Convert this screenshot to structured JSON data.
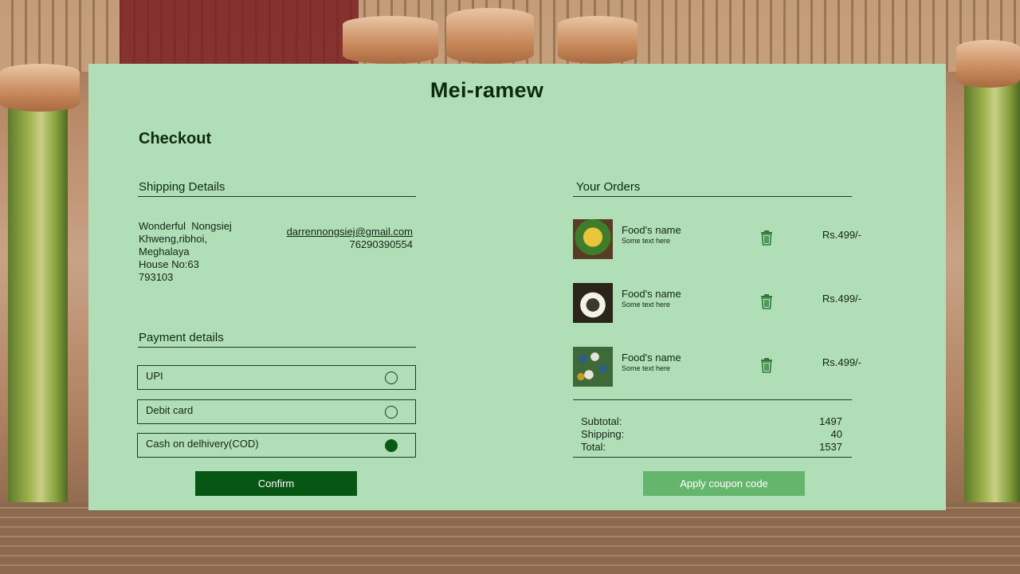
{
  "app": {
    "title": "Mei-ramew"
  },
  "checkout": {
    "title": "Checkout"
  },
  "shipping": {
    "heading": "Shipping Details",
    "address_lines": [
      "Wonderful  Nongsiej",
      "Khweng,ribhoi,",
      "Meghalaya",
      "House No:63",
      "793103"
    ],
    "email": "darrennongsiej@gmail.com",
    "phone": "76290390554"
  },
  "payment": {
    "heading": "Payment details",
    "options": [
      {
        "label": "UPI",
        "selected": false
      },
      {
        "label": "Debit card",
        "selected": false
      },
      {
        "label": "Cash on delhivery(COD)",
        "selected": true
      }
    ],
    "confirm_label": "Confirm"
  },
  "orders": {
    "heading": "Your Orders",
    "items": [
      {
        "name": "Food's name",
        "desc": "Some text here",
        "price": "Rs.499/-",
        "icon": "trash-icon"
      },
      {
        "name": "Food's name",
        "desc": "Some text here",
        "price": "Rs.499/-",
        "icon": "trash-icon"
      },
      {
        "name": "Food's name",
        "desc": "Some text here",
        "price": "Rs.499/-",
        "icon": "trash-icon"
      }
    ],
    "totals": {
      "subtotal_label": "Subtotal:",
      "subtotal": "1497",
      "shipping_label": "Shipping:",
      "shipping": "40",
      "total_label": "Total:",
      "total": "1537"
    },
    "coupon_label": "Apply coupon code"
  },
  "colors": {
    "card_bg": "#b0dfb7",
    "confirm_bg": "#085613",
    "coupon_bg": "#66b56d",
    "selected_radio": "#0b5a13"
  }
}
